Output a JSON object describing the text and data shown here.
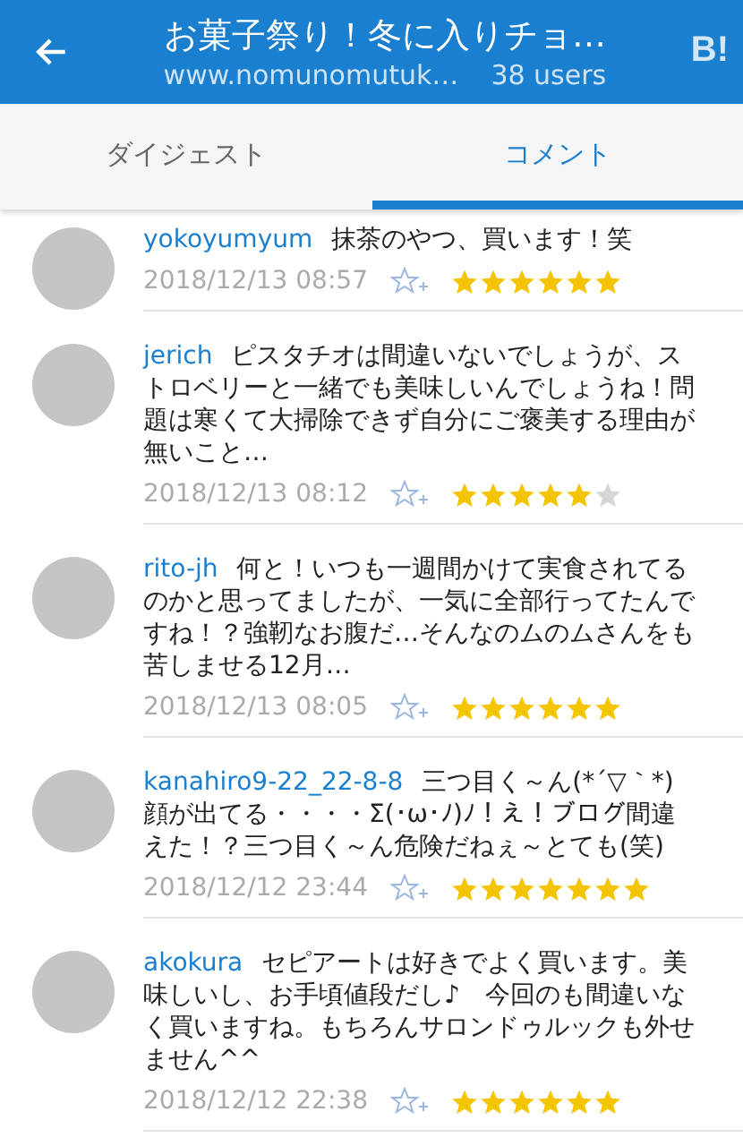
{
  "header": {
    "title": "お菓子祭り！冬に入りチョ…",
    "site": "www.nomunomutuk…",
    "users": "38 users",
    "logo": "B!"
  },
  "tabs": [
    {
      "label": "ダイジェスト",
      "selected": false
    },
    {
      "label": "コメント",
      "selected": true
    }
  ],
  "comments": [
    {
      "user": "yokoyumyum",
      "text": "抹茶のやつ、買います！笑",
      "time": "2018/12/13 08:57",
      "stars": [
        {
          "color": "#f5c400"
        },
        {
          "color": "#f5c400"
        },
        {
          "color": "#f5c400"
        },
        {
          "color": "#f5c400"
        },
        {
          "color": "#f5c400"
        },
        {
          "color": "#f5c400"
        }
      ]
    },
    {
      "user": "jerich",
      "text": "ピスタチオは間違いないでしょうが、ストロベリーと一緒でも美味しいんでしょうね！問題は寒くて大掃除できず自分にご褒美する理由が無いこと…",
      "time": "2018/12/13 08:12",
      "stars": [
        {
          "color": "#f5c400"
        },
        {
          "color": "#f5c400"
        },
        {
          "color": "#f5c400"
        },
        {
          "color": "#f5c400"
        },
        {
          "color": "#f5c400"
        },
        {
          "color": "#d6d6d6"
        }
      ]
    },
    {
      "user": "rito-jh",
      "text": "何と！いつも一週間かけて実食されてるのかと思ってましたが、一気に全部行ってたんですね！？強靭なお腹だ…そんなのムのムさんをも苦しませる12月…",
      "time": "2018/12/13 08:05",
      "stars": [
        {
          "color": "#f5c400"
        },
        {
          "color": "#f5c400"
        },
        {
          "color": "#f5c400"
        },
        {
          "color": "#f5c400"
        },
        {
          "color": "#f5c400"
        },
        {
          "color": "#f5c400"
        }
      ]
    },
    {
      "user": "kanahiro9-22_22-8-8",
      "text": "三つ目く～ん(*´▽｀*)顔が出てる・・・・Σ(･ω･ﾉ)ﾉ！え！ブログ間違えた！？三つ目く～ん危険だねぇ～とても(笑)",
      "time": "2018/12/12 23:44",
      "stars": [
        {
          "color": "#f5c400"
        },
        {
          "color": "#f5c400"
        },
        {
          "color": "#f5c400"
        },
        {
          "color": "#f5c400"
        },
        {
          "color": "#f5c400"
        },
        {
          "color": "#f5c400"
        },
        {
          "color": "#f5c400"
        }
      ]
    },
    {
      "user": "akokura",
      "text": "セピアートは好きでよく買います。美味しいし、お手頃値段だし♪　今回のも間違いなく買いますね。もちろんサロンドゥルックも外せません^^",
      "time": "2018/12/12 22:38",
      "stars": [
        {
          "color": "#f5c400"
        },
        {
          "color": "#f5c400"
        },
        {
          "color": "#f5c400"
        },
        {
          "color": "#f5c400"
        },
        {
          "color": "#f5c400"
        },
        {
          "color": "#f5c400"
        }
      ]
    }
  ]
}
